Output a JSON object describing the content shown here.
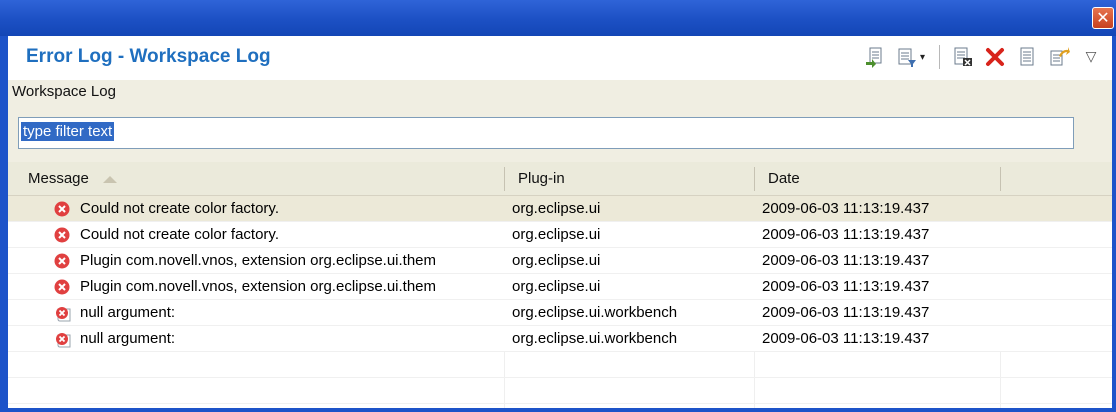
{
  "view": {
    "title": "Error Log - Workspace Log",
    "breadcrumb": "Workspace Log",
    "close_glyph": "✕"
  },
  "toolbar": {
    "buttons": [
      {
        "name": "export-log-icon",
        "dropdown": false
      },
      {
        "name": "filter-icon",
        "dropdown": true
      },
      {
        "name": "clear-log-icon",
        "dropdown": false
      },
      {
        "name": "delete-log-icon",
        "dropdown": false
      },
      {
        "name": "open-log-icon",
        "dropdown": false
      },
      {
        "name": "restore-log-icon",
        "dropdown": false
      }
    ],
    "view_menu_glyph": "▽",
    "dropdown_glyph": "▾"
  },
  "filter": {
    "value": "type filter text"
  },
  "table": {
    "columns": [
      "Message",
      "Plug-in",
      "Date"
    ],
    "sort_column": "Message",
    "rows": [
      {
        "message": "Could not create color factory.",
        "plugin": "org.eclipse.ui",
        "date": "2009-06-03 11:13:19.437",
        "icon": "error-icon",
        "selected": true
      },
      {
        "message": "Could not create color factory.",
        "plugin": "org.eclipse.ui",
        "date": "2009-06-03 11:13:19.437",
        "icon": "error-icon",
        "selected": false
      },
      {
        "message": "Plugin com.novell.vnos, extension org.eclipse.ui.them",
        "plugin": "org.eclipse.ui",
        "date": "2009-06-03 11:13:19.437",
        "icon": "error-icon",
        "selected": false
      },
      {
        "message": "Plugin com.novell.vnos, extension org.eclipse.ui.them",
        "plugin": "org.eclipse.ui",
        "date": "2009-06-03 11:13:19.437",
        "icon": "error-icon",
        "selected": false
      },
      {
        "message": "null argument:",
        "plugin": "org.eclipse.ui.workbench",
        "date": "2009-06-03 11:13:19.437",
        "icon": "error-stack-icon",
        "selected": false
      },
      {
        "message": "null argument:",
        "plugin": "org.eclipse.ui.workbench",
        "date": "2009-06-03 11:13:19.437",
        "icon": "error-stack-icon",
        "selected": false
      }
    ]
  },
  "colors": {
    "title_blue": "#1f6fbf",
    "window_border": "#1d53c9",
    "selection_row": "#ece9d8",
    "error_red": "#e04040"
  }
}
